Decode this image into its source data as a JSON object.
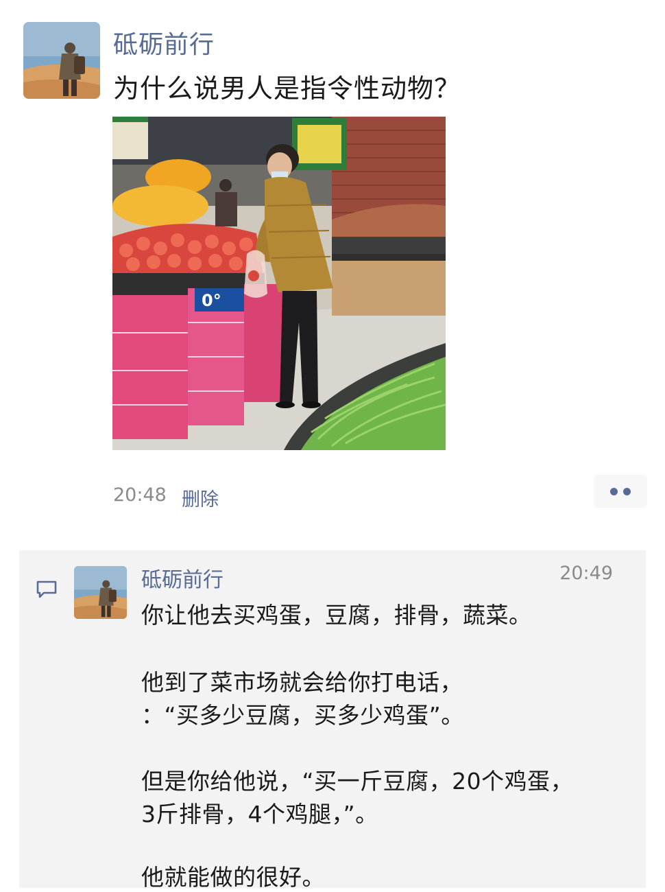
{
  "post": {
    "author": "砥砺前行",
    "text": "为什么说男人是指令性动物？",
    "time": "20:48",
    "delete_label": "删除",
    "photo_sign": "0°"
  },
  "comment": {
    "author": "砥砺前行",
    "time": "20:49",
    "lines": [
      "你让他去买鸡蛋，豆腐，排骨，蔬菜。",
      "他到了菜市场就会给你打电话，",
      "：“买多少豆腐，买多少鸡蛋”。",
      "但是你给他说，“买一斤豆腐，20个鸡蛋，",
      "3斤排骨，4个鸡腿，”。",
      "他就能做的很好。"
    ]
  },
  "icons": {
    "more": "more-dots-icon",
    "comment": "comment-bubble-icon"
  },
  "colors": {
    "link": "#576b95",
    "text": "#1a1a1a",
    "meta": "#8a8a8a",
    "panel": "#f3f3f3"
  }
}
